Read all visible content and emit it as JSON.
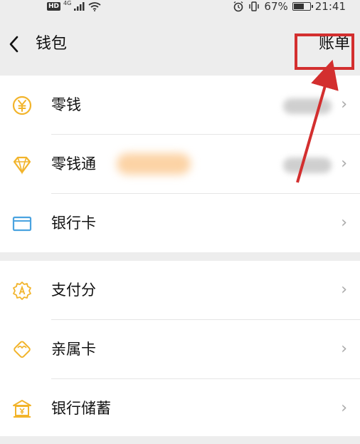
{
  "status_bar": {
    "hd": "HD",
    "network": "4G",
    "battery_percent": "67%",
    "time": "21:41",
    "battery_level": 0.67
  },
  "nav": {
    "back_icon": "chevron-left-icon",
    "title": "钱包",
    "bill_label": "账单"
  },
  "sections": [
    {
      "items": [
        {
          "label": "零钱",
          "icon": "yuan-coin-icon",
          "value_blurred": true
        },
        {
          "label": "零钱通",
          "icon": "diamond-icon",
          "value_blurred": true
        },
        {
          "label": "银行卡",
          "icon": "bank-card-icon",
          "value_blurred": false
        }
      ]
    },
    {
      "items": [
        {
          "label": "支付分",
          "icon": "badge-score-icon"
        },
        {
          "label": "亲属卡",
          "icon": "heart-card-icon"
        },
        {
          "label": "银行储蓄",
          "icon": "bank-savings-icon"
        }
      ]
    }
  ],
  "colors": {
    "accent_icon": "#f2b42b",
    "card_icon": "#4aa3e0",
    "highlight": "#d32f2f",
    "background": "#ededed"
  }
}
